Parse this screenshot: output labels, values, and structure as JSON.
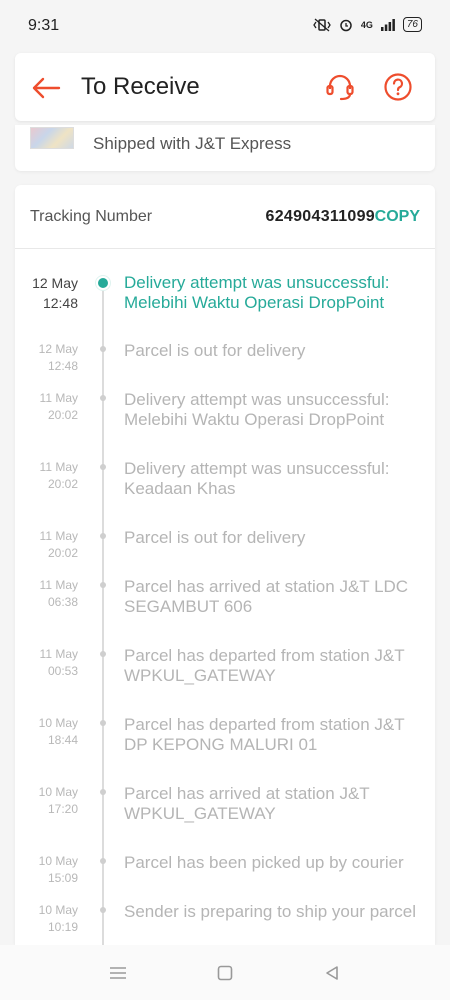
{
  "status_bar": {
    "time": "9:31",
    "network": "4G",
    "battery": "76"
  },
  "header": {
    "title": "To Receive",
    "back_icon": "arrow-left-icon",
    "support_icon": "headset-icon",
    "help_icon": "question-circle-icon",
    "accent_color": "#ee4d2d"
  },
  "shipping": {
    "label": "Shipped with J&T Express"
  },
  "tracking": {
    "label": "Tracking Number",
    "number": "624904311099",
    "copy_label": "COPY",
    "accent_color": "#26aa99"
  },
  "events": [
    {
      "date": "12 May",
      "time": "12:48",
      "text": "Delivery attempt was unsuccessful: Melebihi Waktu Operasi DropPoint",
      "active": true
    },
    {
      "date": "12 May",
      "time": "12:48",
      "text": "Parcel is out for delivery",
      "active": false
    },
    {
      "date": "11 May",
      "time": "20:02",
      "text": "Delivery attempt was unsuccessful: Melebihi Waktu Operasi DropPoint",
      "active": false
    },
    {
      "date": "11 May",
      "time": "20:02",
      "text": "Delivery attempt was unsuccessful: Keadaan Khas",
      "active": false
    },
    {
      "date": "11 May",
      "time": "20:02",
      "text": "Parcel is out for delivery",
      "active": false
    },
    {
      "date": "11 May",
      "time": "06:38",
      "text": "Parcel has arrived at station J&T LDC SEGAMBUT 606",
      "active": false
    },
    {
      "date": "11 May",
      "time": "00:53",
      "text": "Parcel has departed from station J&T WPKUL_GATEWAY",
      "active": false
    },
    {
      "date": "10 May",
      "time": "18:44",
      "text": "Parcel has departed from station J&T DP KEPONG MALURI 01",
      "active": false
    },
    {
      "date": "10 May",
      "time": "17:20",
      "text": "Parcel has arrived at station J&T WPKUL_GATEWAY",
      "active": false
    },
    {
      "date": "10 May",
      "time": "15:09",
      "text": "Parcel has been picked up by courier",
      "active": false
    },
    {
      "date": "10 May",
      "time": "10:19",
      "text": "Sender is preparing to ship your parcel",
      "active": false
    }
  ],
  "nav": {
    "menu_icon": "menu-icon",
    "home_icon": "home-square-icon",
    "back_icon": "back-triangle-icon"
  }
}
